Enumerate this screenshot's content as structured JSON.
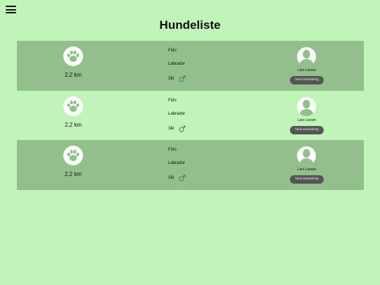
{
  "header": {
    "menu_icon": "hamburger-menu-icon",
    "title": "Hundeliste"
  },
  "colors": {
    "background": "#c0f4b8",
    "row_shaded": "#93bf8d",
    "icon_tint": "#93bf8d",
    "button": "#555555"
  },
  "dogs": [
    {
      "distance": "2,2 km",
      "name": "Fido",
      "breed": "Labrador",
      "age": "3år",
      "gender_icon": "male-icon",
      "owner": "Lars Larsen",
      "request_label": "Send anmodning"
    },
    {
      "distance": "2,2 km",
      "name": "Fido",
      "breed": "Labrador",
      "age": "3år",
      "gender_icon": "male-icon",
      "owner": "Lars Larsen",
      "request_label": "Send anmodning"
    },
    {
      "distance": "2,2 km",
      "name": "Fido",
      "breed": "Labrador",
      "age": "3år",
      "gender_icon": "male-icon",
      "owner": "Lars Larsen",
      "request_label": "Send anmodning"
    }
  ]
}
